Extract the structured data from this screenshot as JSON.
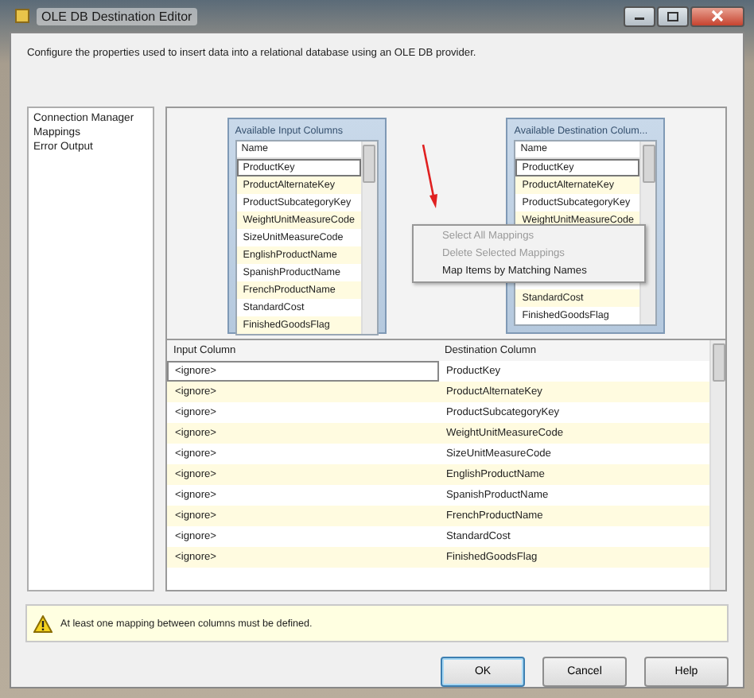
{
  "window": {
    "title": "OLE DB Destination Editor"
  },
  "description": "Configure the properties used to insert data into a relational database using an OLE DB provider.",
  "nav": [
    {
      "label": "Connection Manager"
    },
    {
      "label": "Mappings"
    },
    {
      "label": "Error Output"
    }
  ],
  "input_columns": {
    "title": "Available Input Columns",
    "header": "Name",
    "items": [
      {
        "label": "ProductKey",
        "selected": true
      },
      {
        "label": "ProductAlternateKey",
        "selected": false
      },
      {
        "label": "ProductSubcategoryKey",
        "selected": false
      },
      {
        "label": "WeightUnitMeasureCode",
        "selected": false
      },
      {
        "label": "SizeUnitMeasureCode",
        "selected": false
      },
      {
        "label": "EnglishProductName",
        "selected": false
      },
      {
        "label": "SpanishProductName",
        "selected": false
      },
      {
        "label": "FrenchProductName",
        "selected": false
      },
      {
        "label": "StandardCost",
        "selected": false
      },
      {
        "label": "FinishedGoodsFlag",
        "selected": false
      }
    ]
  },
  "destination_columns": {
    "title": "Available Destination Colum...",
    "header": "Name",
    "items": [
      {
        "label": "ProductKey",
        "selected": true
      },
      {
        "label": "ProductAlternateKey",
        "selected": false
      },
      {
        "label": "ProductSubcategoryKey",
        "selected": false
      },
      {
        "label": "WeightUnitMeasureCode",
        "selected": false
      }
    ],
    "items_below_menu": [
      {
        "label": "StandardCost",
        "selected": false
      },
      {
        "label": "FinishedGoodsFlag",
        "selected": false
      }
    ]
  },
  "context_menu": [
    {
      "label": "Select All Mappings",
      "disabled": true
    },
    {
      "label": "Delete Selected Mappings",
      "disabled": true
    },
    {
      "label": "Map Items by Matching Names",
      "disabled": false
    }
  ],
  "mapping_table": {
    "columns": [
      "Input Column",
      "Destination Column"
    ],
    "rows": [
      {
        "input": "<ignore>",
        "destination": "ProductKey",
        "selected": true
      },
      {
        "input": "<ignore>",
        "destination": "ProductAlternateKey",
        "selected": false
      },
      {
        "input": "<ignore>",
        "destination": "ProductSubcategoryKey",
        "selected": false
      },
      {
        "input": "<ignore>",
        "destination": "WeightUnitMeasureCode",
        "selected": false
      },
      {
        "input": "<ignore>",
        "destination": "SizeUnitMeasureCode",
        "selected": false
      },
      {
        "input": "<ignore>",
        "destination": "EnglishProductName",
        "selected": false
      },
      {
        "input": "<ignore>",
        "destination": "SpanishProductName",
        "selected": false
      },
      {
        "input": "<ignore>",
        "destination": "FrenchProductName",
        "selected": false
      },
      {
        "input": "<ignore>",
        "destination": "StandardCost",
        "selected": false
      },
      {
        "input": "<ignore>",
        "destination": "FinishedGoodsFlag",
        "selected": false
      }
    ]
  },
  "warning": "At least one mapping between columns must be defined.",
  "buttons": [
    {
      "label": "OK",
      "default": true
    },
    {
      "label": "Cancel",
      "default": false
    },
    {
      "label": "Help",
      "default": false
    }
  ]
}
